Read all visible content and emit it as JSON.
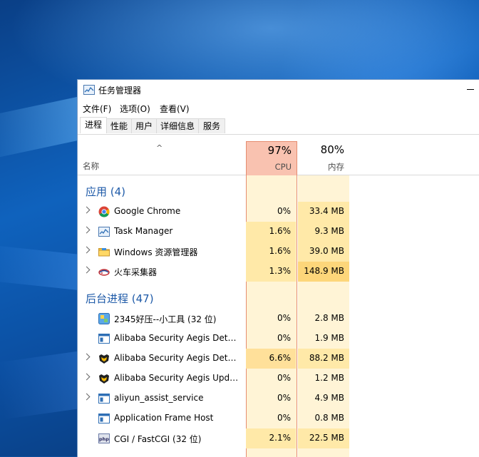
{
  "window": {
    "title": "任务管理器",
    "menu": [
      "文件(F)",
      "选项(O)",
      "查看(V)"
    ],
    "tabs": [
      "进程",
      "性能",
      "用户",
      "详细信息",
      "服务"
    ]
  },
  "columns": {
    "sort_indicator": "^",
    "name": "名称",
    "cpu_percent": "97%",
    "cpu_label": "CPU",
    "mem_percent": "80%",
    "mem_label": "内存"
  },
  "groups": {
    "apps": "应用 (4)",
    "background": "后台进程 (47)"
  },
  "apps": [
    {
      "name": "Google Chrome",
      "cpu": "0%",
      "mem": "33.4 MB",
      "icon": "chrome-icon",
      "expandable": true
    },
    {
      "name": "Task Manager",
      "cpu": "1.6%",
      "mem": "9.3 MB",
      "icon": "task-manager-icon",
      "expandable": true
    },
    {
      "name": "Windows 资源管理器",
      "cpu": "1.6%",
      "mem": "39.0 MB",
      "icon": "folder-icon",
      "expandable": true
    },
    {
      "name": "火车采集器",
      "cpu": "1.3%",
      "mem": "148.9 MB",
      "icon": "train-icon",
      "expandable": true
    }
  ],
  "background": [
    {
      "name": "2345好压--小工具 (32 位)",
      "cpu": "0%",
      "mem": "2.8 MB",
      "icon": "haozip-icon",
      "expandable": false
    },
    {
      "name": "Alibaba Security Aegis Detect",
      "cpu": "0%",
      "mem": "1.9 MB",
      "icon": "app-window-icon",
      "expandable": false
    },
    {
      "name": "Alibaba Security Aegis Detect",
      "cpu": "6.6%",
      "mem": "88.2 MB",
      "icon": "aegis-icon",
      "expandable": true
    },
    {
      "name": "Alibaba Security Aegis Update",
      "cpu": "0%",
      "mem": "1.2 MB",
      "icon": "aegis-icon",
      "expandable": true
    },
    {
      "name": "aliyun_assist_service",
      "cpu": "0%",
      "mem": "4.9 MB",
      "icon": "app-window-icon",
      "expandable": true
    },
    {
      "name": "Application Frame Host",
      "cpu": "0%",
      "mem": "0.8 MB",
      "icon": "app-window-icon",
      "expandable": false
    },
    {
      "name": "CGI / FastCGI (32 位)",
      "cpu": "2.1%",
      "mem": "22.5 MB",
      "icon": "php-icon",
      "expandable": false
    }
  ],
  "colors": {
    "cpu_header_bg": "#f9c2b0",
    "heat_light": "#fff4d6",
    "heat_medium": "#ffe9a8",
    "group_text": "#1e5aa8"
  }
}
